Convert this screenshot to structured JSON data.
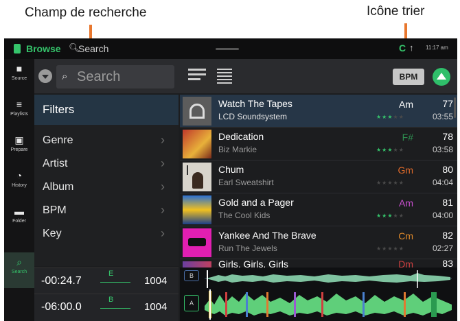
{
  "callouts": {
    "search_field": "Champ de recherche",
    "sort_icon": "Icône trier"
  },
  "topbar": {
    "browse": "Browse",
    "search": "Search",
    "status_letter": "C",
    "time": "11:17 am"
  },
  "rail": [
    {
      "label": "Source",
      "icon": "source-icon"
    },
    {
      "label": "Playlists",
      "icon": "playlists-icon"
    },
    {
      "label": "Prepare",
      "icon": "prepare-icon"
    },
    {
      "label": "History",
      "icon": "history-icon"
    },
    {
      "label": "Folder",
      "icon": "folder-icon"
    },
    {
      "label": "Search",
      "icon": "search-icon",
      "active": true
    }
  ],
  "header": {
    "search_placeholder": "Search",
    "sort_label": "BPM"
  },
  "filters": {
    "title": "Filters",
    "items": [
      "Genre",
      "Artist",
      "Album",
      "BPM",
      "Key"
    ]
  },
  "decks": [
    {
      "time": "-00:24.7",
      "key": "E",
      "bpm": "1004"
    },
    {
      "time": "-06:00.0",
      "key": "B",
      "bpm": "1004"
    }
  ],
  "tracks": [
    {
      "title": "Watch The Tapes",
      "artist": "LCD Soundsystem",
      "key": "Am",
      "key_color": "#ffffff",
      "bpm": "77",
      "length": "03:55",
      "rating": 3
    },
    {
      "title": "Dedication",
      "artist": "Biz Markie",
      "key": "F#",
      "key_color": "#2e8f50",
      "bpm": "78",
      "length": "03:58",
      "rating": 3
    },
    {
      "title": "Chum",
      "artist": "Earl Sweatshirt",
      "key": "Gm",
      "key_color": "#e06a2a",
      "bpm": "80",
      "length": "04:04",
      "rating": 0
    },
    {
      "title": "Gold and a Pager",
      "artist": "The Cool Kids",
      "key": "Am",
      "key_color": "#c94fd0",
      "bpm": "81",
      "length": "04:00",
      "rating": 3
    },
    {
      "title": "Yankee And The Brave",
      "artist": "Run The Jewels",
      "key": "Cm",
      "key_color": "#e08a2a",
      "bpm": "82",
      "length": "02:27",
      "rating": 0
    },
    {
      "title": "Girls, Girls, Girls",
      "artist": "",
      "key": "Dm",
      "key_color": "#d04040",
      "bpm": "83",
      "length": "",
      "rating": 0
    }
  ],
  "waveforms": {
    "deck_b_badge": "B",
    "deck_a_badge": "A"
  }
}
